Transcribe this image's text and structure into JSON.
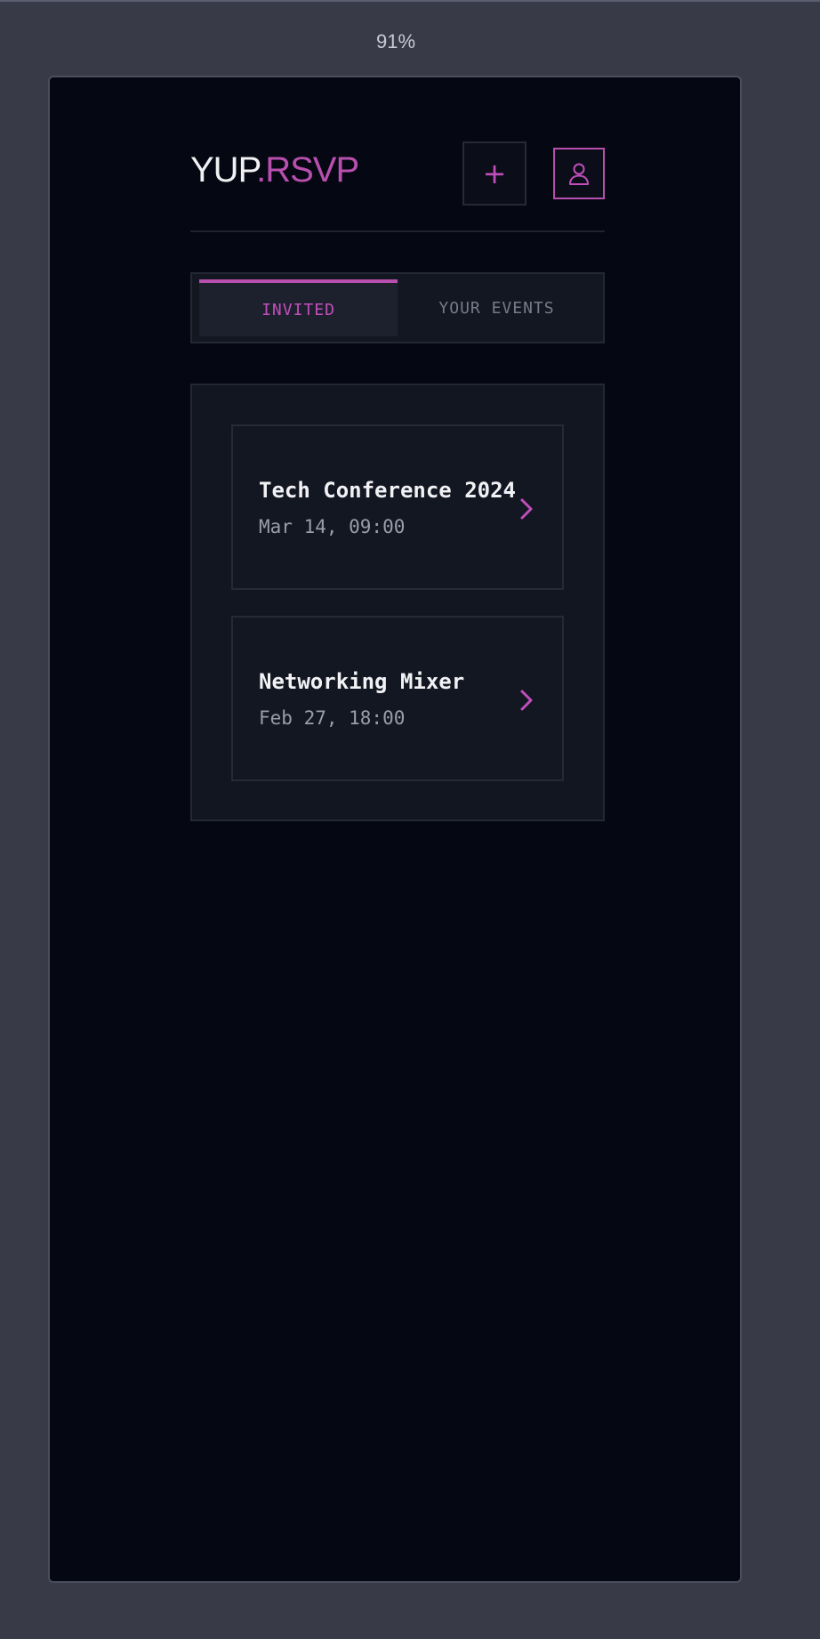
{
  "zoom_level": "91%",
  "brand": {
    "name_main": "YUP",
    "name_accent": ".RSVP",
    "accent_color": "#b84fae"
  },
  "header": {
    "add_button_icon": "plus-icon",
    "add_button_glyph": "+",
    "profile_button_icon": "user-icon"
  },
  "tabs": [
    {
      "label": "INVITED",
      "active": true
    },
    {
      "label": "YOUR EVENTS",
      "active": false
    }
  ],
  "events": [
    {
      "title": "Tech Conference 2024",
      "date": "Mar 14, 09:00",
      "icon": "chevron-right-icon"
    },
    {
      "title": "Networking Mixer",
      "date": "Feb 27, 18:00",
      "icon": "chevron-right-icon"
    }
  ]
}
